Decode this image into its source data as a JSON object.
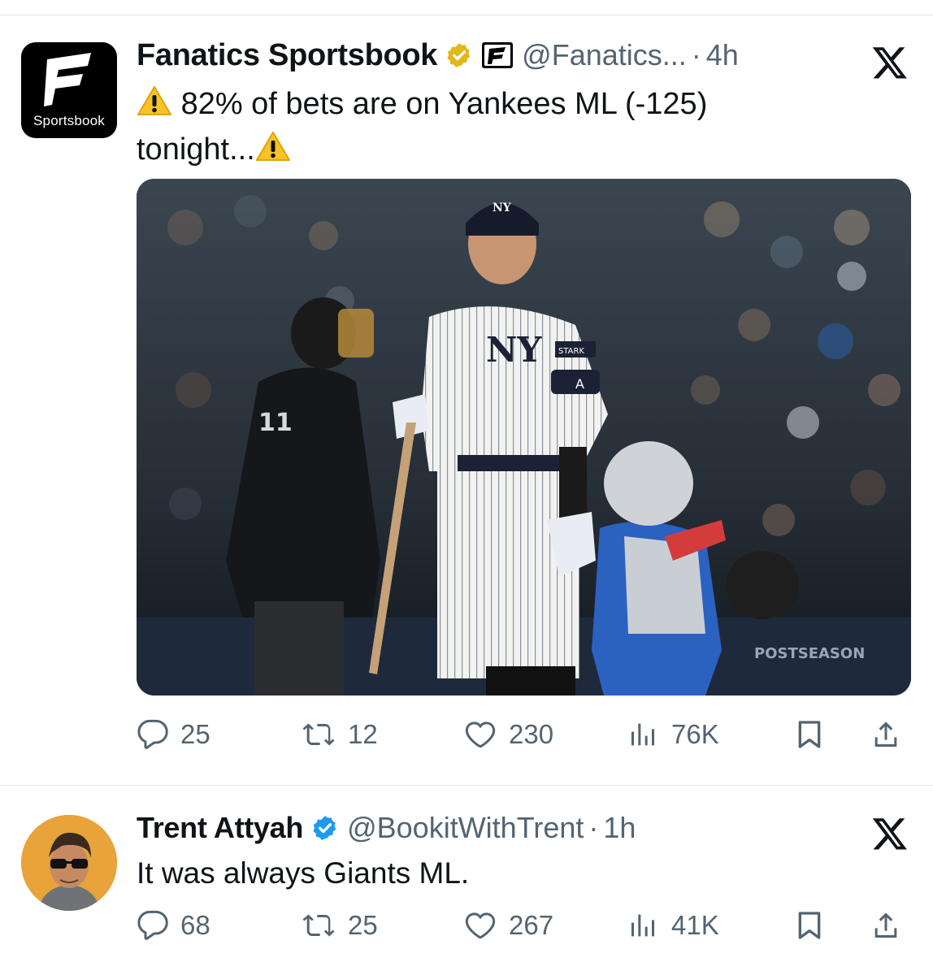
{
  "tweets": [
    {
      "author": {
        "name": "Fanatics Sportsbook",
        "handle": "@Fanatics...",
        "verified": "gold",
        "avatar_label": "Sportsbook"
      },
      "time": "4h",
      "separator": "·",
      "text_before": "82% of bets are on Yankees ML (-125) tonight...",
      "emoji": "warning-icon",
      "media": {
        "type": "photo",
        "jersey_letters": "NY",
        "umpire_number": "11",
        "sleeve_patch": "STARK",
        "armband_letter": "A",
        "wall_text": "POSTSEASON"
      },
      "stats": {
        "replies": "25",
        "retweets": "12",
        "likes": "230",
        "views": "76K"
      }
    },
    {
      "author": {
        "name": "Trent Attyah",
        "handle": "@BookitWithTrent",
        "verified": "blue"
      },
      "time": "1h",
      "separator": "·",
      "text": "It was always Giants ML.",
      "stats": {
        "replies": "68",
        "retweets": "25",
        "likes": "267",
        "views": "41K"
      }
    }
  ],
  "colors": {
    "text": "#0f1419",
    "secondary": "#536471",
    "gold_badge": "#e2b719",
    "blue_badge": "#1d9bf0",
    "divider": "#e6e6e6"
  }
}
